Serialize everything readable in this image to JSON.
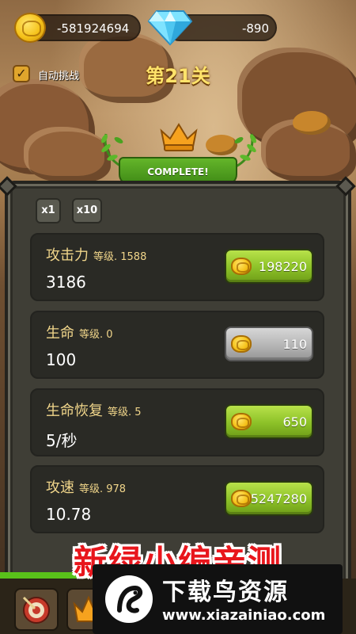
{
  "currency": {
    "coins": "-581924694",
    "gems": "-890"
  },
  "auto_challenge": {
    "label": "自动挑战",
    "checked": true
  },
  "level": {
    "title": "第21关",
    "status": "COMPLETE!"
  },
  "multipliers": [
    "x1",
    "x10"
  ],
  "upgrades": [
    {
      "name": "攻击力",
      "level": "等级. 1588",
      "value": "3186",
      "cost": "198220",
      "affordable": true
    },
    {
      "name": "生命",
      "level": "等级. 0",
      "value": "100",
      "cost": "110",
      "affordable": false
    },
    {
      "name": "生命恢复",
      "level": "等级. 5",
      "value": "5/秒",
      "cost": "650",
      "affordable": true
    },
    {
      "name": "攻速",
      "level": "等级. 978",
      "value": "10.78",
      "cost": "5247280",
      "affordable": true
    }
  ],
  "watermark": {
    "headline": "新绿小编亲测",
    "site_name": "下载鸟资源",
    "url": "www.xiazainiao.com"
  },
  "colors": {
    "accent_green": "#8cc128",
    "gold": "#f5c21a",
    "title_yellow": "#ffe36a",
    "watermark_red": "#e8161c"
  }
}
